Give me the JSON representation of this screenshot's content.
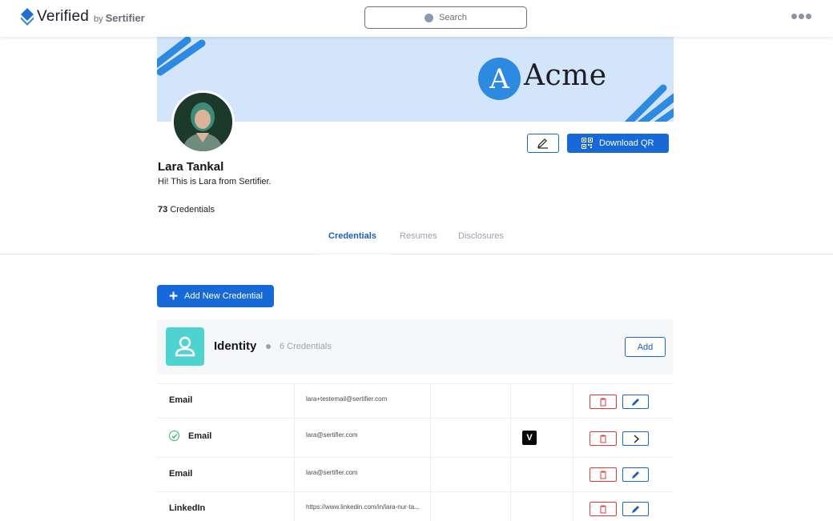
{
  "app": {
    "logo_main": "Verified",
    "logo_by": "by",
    "logo_brand": "Sertifier",
    "search_placeholder": "Search"
  },
  "cover": {
    "company_initial": "A",
    "company_name": "Acme"
  },
  "profile": {
    "name": "Lara Tankal",
    "bio": "Hi! This is Lara from Sertifier.",
    "credential_count": "73",
    "credential_count_label": "Credentials",
    "download_qr_label": "Download QR"
  },
  "tabs": [
    {
      "label": "Credentials",
      "active": true
    },
    {
      "label": "Resumes",
      "active": false
    },
    {
      "label": "Disclosures",
      "active": false
    }
  ],
  "actions": {
    "add_credential_label": "Add New Credential"
  },
  "identity": {
    "title": "Identity",
    "count_label": "6 Credentials",
    "add_label": "Add"
  },
  "rows": [
    {
      "label": "Email",
      "value": "lara+testemail@sertifier.com",
      "verified": false,
      "badge": "",
      "action": "edit"
    },
    {
      "label": "Email",
      "value": "lara@sertifier.com",
      "verified": true,
      "badge": "V",
      "action": "open"
    },
    {
      "label": "Email",
      "value": "lara@sertifier.com",
      "verified": false,
      "badge": "",
      "action": "edit"
    },
    {
      "label": "LinkedIn",
      "value": "https://www.linkedin.com/in/lara-nur-ta...",
      "verified": false,
      "badge": "",
      "action": "edit"
    }
  ],
  "colors": {
    "primary": "#1769d8",
    "cover_bg": "#d3e5fb",
    "cover_stripes": "#2d8ae0",
    "identity_icon_bg": "#4dd4d0",
    "delete_red": "#e03a3a",
    "verified_green": "#33b56a"
  },
  "icons": {
    "logo": "verified-diamond-icon",
    "search": "search-icon",
    "more": "more-dots-icon",
    "edit_profile": "pencil-icon",
    "qr": "qr-code-icon",
    "add": "plus-icon",
    "identity": "user-icon",
    "delete": "trash-icon",
    "edit": "pencil-icon",
    "open": "chevron-right-icon",
    "verified": "check-circle-icon"
  }
}
